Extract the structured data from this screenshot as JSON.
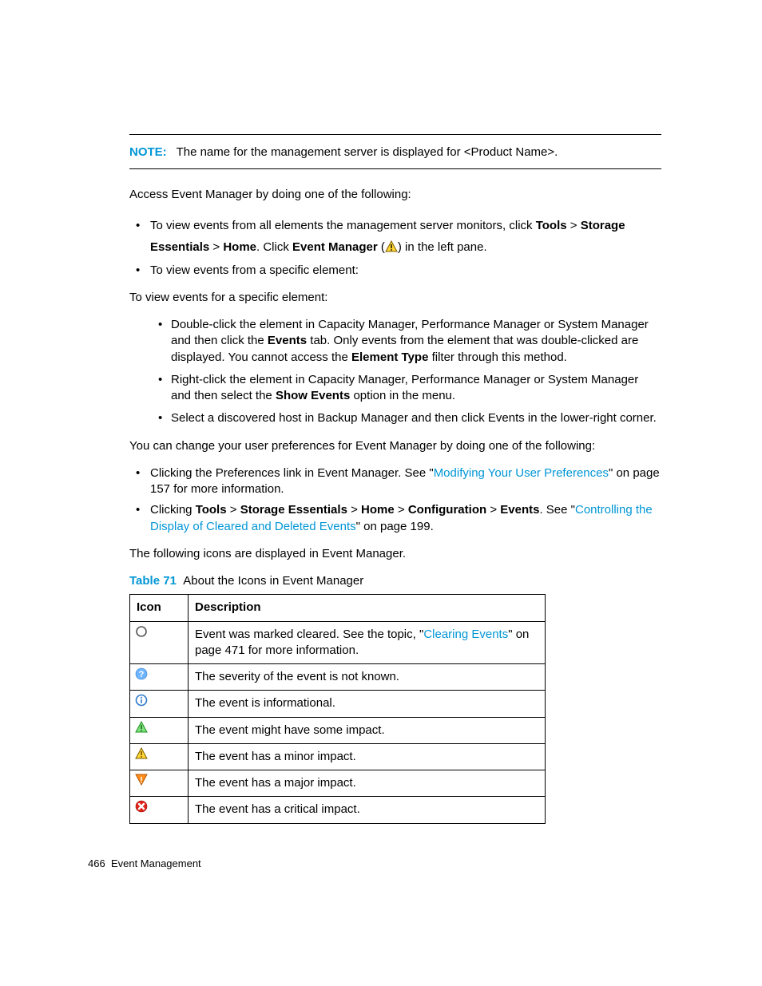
{
  "note": {
    "label": "NOTE:",
    "text": "The name for the management server is displayed for <Product Name>."
  },
  "p1": "Access Event Manager by doing one of the following:",
  "bullets1": {
    "b1_pre": "To view events from all elements the management server monitors, click ",
    "b1_tools": "Tools",
    "b1_gt1": " > ",
    "b1_se": "Storage Essentials",
    "b1_gt2": " > ",
    "b1_home": "Home",
    "b1_click": ". Click ",
    "b1_em": "Event Manager",
    "b1_open": " (",
    "b1_close": ") in the left pane.",
    "b2": "To view events from a specific element:"
  },
  "p2": "To view events for a specific element:",
  "inner": {
    "i1_a": "Double-click the element in Capacity Manager, Performance Manager or System Manager and then click the ",
    "i1_events": "Events",
    "i1_b": " tab. Only events from the element that was double-clicked are displayed. You cannot access the ",
    "i1_etype": "Element Type",
    "i1_c": " filter through this method.",
    "i2_a": "Right-click the element in Capacity Manager, Performance Manager or System Manager and then select the ",
    "i2_show": "Show Events",
    "i2_b": " option in the menu.",
    "i3": "Select a discovered host in Backup Manager and then click Events in the lower-right corner."
  },
  "p3": "You can change your user preferences for Event Manager by doing one of the following:",
  "bullets2": {
    "c1_a": "Clicking the Preferences link in Event Manager. See \"",
    "c1_link": "Modifying Your User Preferences",
    "c1_b": "\" on page 157 for more information.",
    "c2_a": "Clicking ",
    "c2_tools": "Tools",
    "c2_g1": " > ",
    "c2_se": "Storage Essentials",
    "c2_g2": " > ",
    "c2_home": "Home",
    "c2_g3": " > ",
    "c2_conf": "Configuration",
    "c2_g4": " > ",
    "c2_events": "Events",
    "c2_see": ". See \"",
    "c2_link": "Controlling the Display of Cleared and Deleted Events",
    "c2_end": "\" on page 199."
  },
  "p4": "The following icons are displayed in Event Manager.",
  "table": {
    "num": "Table 71",
    "title": "About the Icons in Event Manager",
    "h_icon": "Icon",
    "h_desc": "Description",
    "rows": [
      {
        "icon": "cleared",
        "d_a": "Event was marked cleared. See the topic, \"",
        "d_link": "Clearing Events",
        "d_b": "\" on page 471 for more information."
      },
      {
        "icon": "unknown",
        "d_a": "The severity of the event is not known.",
        "d_link": "",
        "d_b": ""
      },
      {
        "icon": "info",
        "d_a": "The event is informational.",
        "d_link": "",
        "d_b": ""
      },
      {
        "icon": "minor1",
        "d_a": "The event might have some impact.",
        "d_link": "",
        "d_b": ""
      },
      {
        "icon": "minor2",
        "d_a": "The event has a minor impact.",
        "d_link": "",
        "d_b": ""
      },
      {
        "icon": "major",
        "d_a": "The event has a major impact.",
        "d_link": "",
        "d_b": ""
      },
      {
        "icon": "critical",
        "d_a": "The event has a critical impact.",
        "d_link": "",
        "d_b": ""
      }
    ]
  },
  "footer": {
    "page": "466",
    "section": "Event Management"
  }
}
